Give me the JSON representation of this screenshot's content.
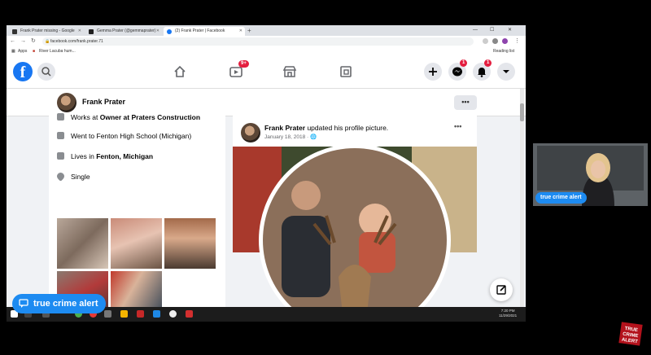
{
  "browser": {
    "tabs": [
      {
        "title": "Frank Prater missing - Google",
        "favicon_color": "#333333",
        "active": false
      },
      {
        "title": "Gemma Prater (@gemmaprater)",
        "favicon_color": "#202020",
        "active": false
      },
      {
        "title": "(2) Frank Prater | Facebook",
        "favicon_color": "#1877f2",
        "active": true
      }
    ],
    "new_tab_label": "+",
    "url": "facebook.com/frank.prater.71",
    "bookmarks": {
      "apps": "Apps",
      "item1": "River Lacuba hum...",
      "reading_list": "Reading list"
    }
  },
  "facebook": {
    "logo": "f",
    "badges": {
      "watch": "9+",
      "messenger": "1",
      "notifications": "1"
    },
    "profile_name": "Frank Prater",
    "more_label": "•••",
    "intro": {
      "works": {
        "prefix": "Works at ",
        "place": "Owner at Praters Construction"
      },
      "school": "Went to Fenton High School (Michigan)",
      "lives": {
        "prefix": "Lives in ",
        "place": "Fenton, Michigan"
      },
      "relationship": "Single"
    },
    "post": {
      "author": "Frank Prater",
      "action": " updated his profile picture.",
      "date": "January 18, 2018 · ",
      "more": "•••"
    }
  },
  "taskbar": {
    "time": "7:20 PM",
    "date": "11/29/2021"
  },
  "overlay": {
    "label_main": "true crime alert",
    "label_cam": "true crime alert",
    "colors": {
      "brand": "#1d8bf1",
      "facebook": "#1877f2",
      "badge": "#e41e3f"
    }
  }
}
